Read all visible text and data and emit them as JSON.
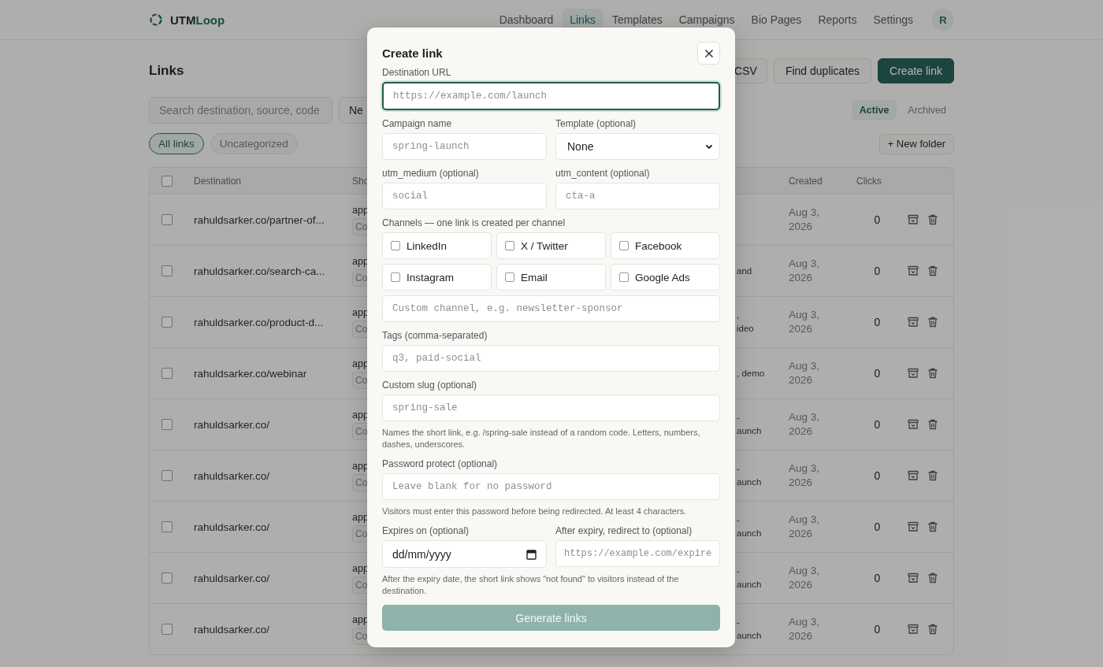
{
  "brand": {
    "name": "UTM",
    "accent": "Loop"
  },
  "nav": [
    {
      "label": "Dashboard",
      "selected": false
    },
    {
      "label": "Links",
      "selected": true
    },
    {
      "label": "Templates",
      "selected": false
    },
    {
      "label": "Campaigns",
      "selected": false
    },
    {
      "label": "Bio Pages",
      "selected": false
    },
    {
      "label": "Reports",
      "selected": false
    },
    {
      "label": "Settings",
      "selected": false
    }
  ],
  "avatar": "R",
  "page": {
    "title": "Links",
    "actions": [
      {
        "label": "CSV",
        "kind": "outline"
      },
      {
        "label": "Find duplicates",
        "kind": "outline"
      },
      {
        "label": "Create link",
        "kind": "primary"
      }
    ],
    "search": {
      "placeholder": "Search destination, source, code"
    },
    "new_button": "Ne",
    "views": [
      {
        "label": "Active",
        "selected": true
      },
      {
        "label": "Archived",
        "selected": false
      }
    ],
    "folders": [
      {
        "label": "All links",
        "selected": true
      },
      {
        "label": "Uncategorized",
        "selected": false
      }
    ],
    "new_folder": "+ New folder"
  },
  "table": {
    "select_all": {
      "selected": false
    },
    "columns": [
      "Destination",
      "Sho",
      "Created",
      "Clicks"
    ],
    "rows": [
      {
        "selected": false,
        "destination": "rahuldsarker.co/partner-of...",
        "short": "app",
        "copy": "Co",
        "tags": [],
        "created": "Aug 3, 2026",
        "clicks": "0"
      },
      {
        "selected": false,
        "destination": "rahuldsarker.co/search-ca...",
        "short": "app",
        "copy": "Co",
        "tags": [
          "and"
        ],
        "created": "Aug 3, 2026",
        "clicks": "0"
      },
      {
        "selected": false,
        "destination": "rahuldsarker.co/product-d...",
        "short": "app",
        "copy": "Co",
        "tags": [
          ",",
          "ideo"
        ],
        "created": "Aug 3, 2026",
        "clicks": "0"
      },
      {
        "selected": false,
        "destination": "rahuldsarker.co/webinar",
        "short": "app",
        "copy": "Co",
        "tags": [
          ", demo"
        ],
        "created": "Aug 3, 2026",
        "clicks": "0"
      },
      {
        "selected": false,
        "destination": "rahuldsarker.co/",
        "short": "app",
        "copy": "Co",
        "tags": [
          "-",
          "aunch"
        ],
        "created": "Aug 3, 2026",
        "clicks": "0"
      },
      {
        "selected": false,
        "destination": "rahuldsarker.co/",
        "short": "app",
        "copy": "Co",
        "tags": [
          "-",
          "aunch"
        ],
        "created": "Aug 3, 2026",
        "clicks": "0"
      },
      {
        "selected": false,
        "destination": "rahuldsarker.co/",
        "short": "app",
        "copy": "Co",
        "tags": [
          "-",
          "aunch"
        ],
        "created": "Aug 3, 2026",
        "clicks": "0"
      },
      {
        "selected": false,
        "destination": "rahuldsarker.co/",
        "short": "app",
        "copy": "Co",
        "tags": [
          "-",
          "aunch"
        ],
        "created": "Aug 3, 2026",
        "clicks": "0"
      },
      {
        "selected": false,
        "destination": "rahuldsarker.co/",
        "short": "app",
        "copy": "Co",
        "tags": [
          "-",
          "aunch"
        ],
        "created": "Aug 3, 2026",
        "clicks": "0"
      }
    ]
  },
  "modal": {
    "title": "Create link",
    "sections": [
      {
        "kind": "field",
        "label": "Destination URL",
        "placeholder": "https://example.com/launch",
        "focused": true
      },
      {
        "kind": "pair",
        "fields": [
          {
            "kind": "input",
            "label": "Campaign name",
            "placeholder": "spring-launch",
            "focused": false
          },
          {
            "kind": "select",
            "label": "Template (optional)",
            "value": "None"
          }
        ]
      },
      {
        "kind": "pair",
        "fields": [
          {
            "kind": "input",
            "label": "utm_medium (optional)",
            "placeholder": "social",
            "focused": false
          },
          {
            "kind": "input",
            "label": "utm_content (optional)",
            "placeholder": "cta-a",
            "focused": false
          }
        ]
      },
      {
        "kind": "channels",
        "label": "Channels — one link is created per channel",
        "options": [
          {
            "label": "LinkedIn",
            "checked": false
          },
          {
            "label": "X / Twitter",
            "checked": false
          },
          {
            "label": "Facebook",
            "checked": false
          },
          {
            "label": "Instagram",
            "checked": false
          },
          {
            "label": "Email",
            "checked": false
          },
          {
            "label": "Google Ads",
            "checked": false
          }
        ],
        "custom_placeholder": "Custom channel, e.g. newsletter-sponsor"
      },
      {
        "kind": "field",
        "label": "Tags (comma-separated)",
        "placeholder": "q3, paid-social",
        "focused": false
      },
      {
        "kind": "field",
        "label": "Custom slug (optional)",
        "placeholder": "spring-sale",
        "focused": false,
        "hint": "Names the short link, e.g. /spring-sale instead of a random code. Letters, numbers, dashes, underscores."
      },
      {
        "kind": "field",
        "label": "Password protect (optional)",
        "placeholder": "Leave blank for no password",
        "focused": false,
        "hint": "Visitors must enter this password before being redirected. At least 4 characters."
      },
      {
        "kind": "pair",
        "fields": [
          {
            "kind": "date",
            "label": "Expires on (optional)",
            "placeholder": "dd/mm/yyyy"
          },
          {
            "kind": "input",
            "label": "After expiry, redirect to (optional)",
            "placeholder": "https://example.com/expire",
            "focused": false
          }
        ],
        "hint": "After the expiry date, the short link shows \"not found\" to visitors instead of the destination."
      }
    ],
    "submit": {
      "label": "Generate links",
      "disabled": true
    }
  }
}
